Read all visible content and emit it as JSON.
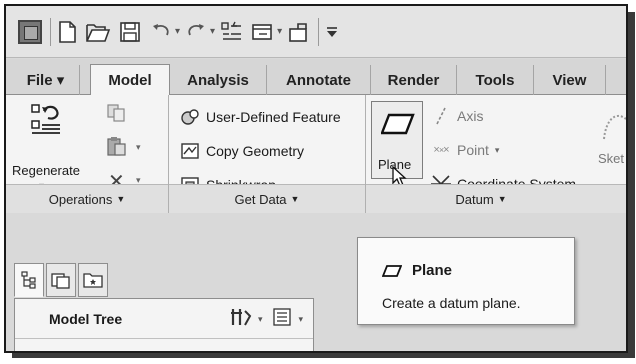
{
  "quick_access": {
    "icons": [
      "app-icon",
      "new-icon",
      "open-icon",
      "save-icon",
      "undo-icon",
      "redo-icon",
      "regenerate-icon",
      "windows-icon",
      "close-window-icon",
      "customize-icon"
    ]
  },
  "tabs": [
    {
      "label": "File ▾",
      "active": false
    },
    {
      "label": "Model",
      "active": true
    },
    {
      "label": "Analysis",
      "active": false
    },
    {
      "label": "Annotate",
      "active": false
    },
    {
      "label": "Render",
      "active": false
    },
    {
      "label": "Tools",
      "active": false
    },
    {
      "label": "View",
      "active": false
    }
  ],
  "ribbon": {
    "operations": {
      "regenerate_label": "Regenerate",
      "group_label": "Operations"
    },
    "get_data": {
      "items": [
        "User-Defined Feature",
        "Copy Geometry",
        "Shrinkwrap"
      ],
      "group_label": "Get Data"
    },
    "datum": {
      "plane_label": "Plane",
      "axis_label": "Axis",
      "point_label": "Point",
      "csys_label": "Coordinate System",
      "group_label": "Datum"
    },
    "sketch_label": "Sket"
  },
  "tooltip": {
    "title": "Plane",
    "description": "Create a datum plane."
  },
  "model_tree": {
    "title": "Model Tree"
  },
  "colors": {
    "ribbon_bg": "#f4f4f4",
    "tab_bar_bg": "#d6d6d6",
    "group_label_bg": "#e0e0e0"
  }
}
